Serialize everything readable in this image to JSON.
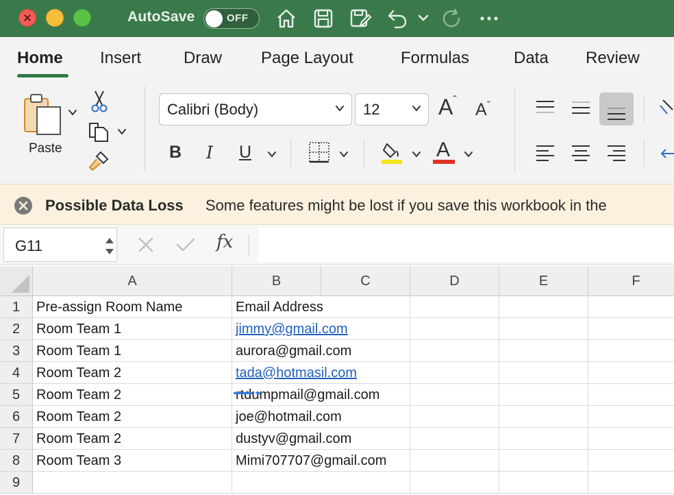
{
  "titlebar": {
    "autosave_label": "AutoSave",
    "toggle_label": "OFF",
    "colors": {
      "bar": "#3a7a4a",
      "close": "#ee5e57",
      "minimize": "#f6be3b",
      "zoom": "#5cc245"
    },
    "icons": [
      "home-icon",
      "save-icon",
      "save-as-icon",
      "undo-icon",
      "chevron-down-icon",
      "redo-icon",
      "more-icon"
    ]
  },
  "tabs": [
    {
      "label": "Home"
    },
    {
      "label": "Insert"
    },
    {
      "label": "Draw"
    },
    {
      "label": "Page Layout"
    },
    {
      "label": "Formulas"
    },
    {
      "label": "Data"
    },
    {
      "label": "Review"
    }
  ],
  "ribbon": {
    "paste_label": "Paste",
    "font_name": "Calibri (Body)",
    "font_size": "12",
    "bold_glyph": "B",
    "italic_glyph": "I",
    "underline_glyph": "U",
    "grow_font_glyph": "A",
    "shrink_font_glyph": "A",
    "font_color_glyph": "A",
    "highlight_color": "#f4e51b",
    "font_color": "#e03323"
  },
  "notice": {
    "title": "Possible Data Loss",
    "message": "Some features might be lost if you save this workbook in the"
  },
  "formula_bar": {
    "cell_reference": "G11",
    "fx_label": "fx",
    "formula": ""
  },
  "sheet": {
    "columns": [
      "A",
      "B",
      "C",
      "D",
      "E",
      "F"
    ],
    "rows": [
      {
        "num": "1",
        "a": "Pre-assign Room Name",
        "b": "Email Address",
        "b_link": false
      },
      {
        "num": "2",
        "a": "Room Team 1",
        "b": "jimmy@gmail.com",
        "b_link": true
      },
      {
        "num": "3",
        "a": "Room Team 1",
        "b": "aurora@gmail.com",
        "b_link": false
      },
      {
        "num": "4",
        "a": "Room Team 2",
        "b": "tada@hotmasil.com",
        "b_link": true
      },
      {
        "num": "5",
        "a": "Room Team 2",
        "b": "rtdumpmail@gmail.com",
        "b_link": false
      },
      {
        "num": "6",
        "a": "Room Team 2",
        "b": "joe@hotmail.com",
        "b_link": false
      },
      {
        "num": "7",
        "a": "Room Team 2",
        "b": "dustyv@gmail.com",
        "b_link": false
      },
      {
        "num": "8",
        "a": "Room Team 3",
        "b": "Mimi707707@gmail.com",
        "b_link": false
      },
      {
        "num": "9",
        "a": "",
        "b": "",
        "b_link": false
      }
    ]
  }
}
